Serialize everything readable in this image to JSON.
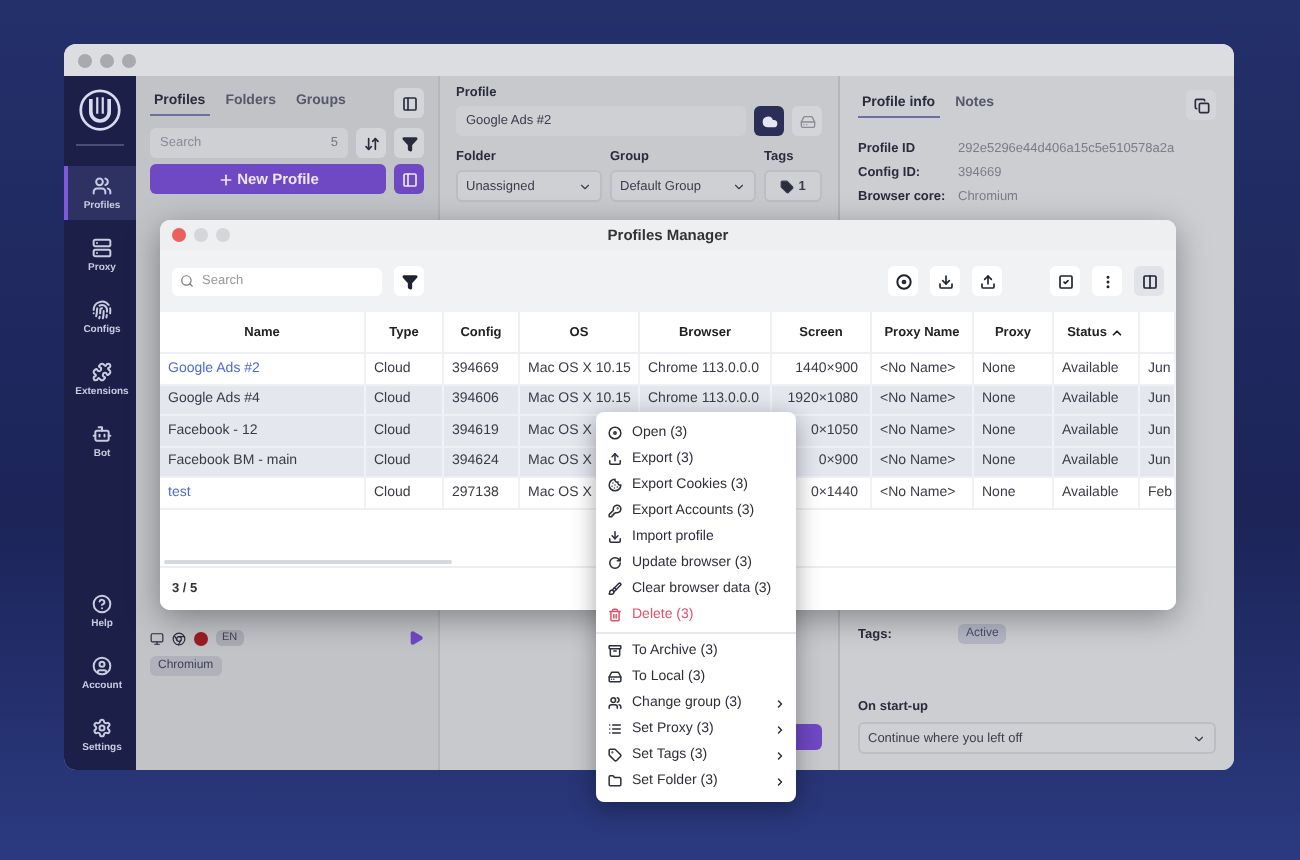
{
  "sidebar": {
    "items": [
      {
        "label": "Profiles",
        "selected": true
      },
      {
        "label": "Proxy",
        "selected": false
      },
      {
        "label": "Configs",
        "selected": false
      },
      {
        "label": "Extensions",
        "selected": false
      },
      {
        "label": "Bot",
        "selected": false
      }
    ],
    "bottom_items": [
      {
        "label": "Help"
      },
      {
        "label": "Account"
      },
      {
        "label": "Settings"
      }
    ]
  },
  "profiles_panel": {
    "tabs": [
      {
        "label": "Profiles",
        "selected": true
      },
      {
        "label": "Folders",
        "selected": false
      },
      {
        "label": "Groups",
        "selected": false
      }
    ],
    "search": {
      "placeholder": "Search",
      "count": "5"
    },
    "new_profile_button": "New Profile",
    "profile_card": {
      "language": "EN",
      "browser_tag": "Chromium"
    }
  },
  "profile_editor": {
    "profile_label": "Profile",
    "profile_name": "Google Ads #2",
    "folder_label": "Folder",
    "folder_value": "Unassigned",
    "group_label": "Group",
    "group_value": "Default Group",
    "tags_label": "Tags",
    "tags_count": "1"
  },
  "profile_info": {
    "tabs": [
      {
        "label": "Profile info",
        "selected": true
      },
      {
        "label": "Notes",
        "selected": false
      }
    ],
    "fields": [
      {
        "label": "Profile ID",
        "value": "292e5296e44d406a15c5e510578a2a"
      },
      {
        "label": "Config ID:",
        "value": "394669"
      },
      {
        "label": "Browser core:",
        "value": "Chromium"
      }
    ],
    "tags_label": "Tags:",
    "tag": "Active",
    "startup_label": "On start-up",
    "startup_value": "Continue where you left off"
  },
  "profiles_manager": {
    "title": "Profiles Manager",
    "search": {
      "placeholder": "Search"
    },
    "columns": [
      {
        "label": "Name",
        "sorted": false
      },
      {
        "label": "Type",
        "sorted": false
      },
      {
        "label": "Config",
        "sorted": false
      },
      {
        "label": "OS",
        "sorted": false
      },
      {
        "label": "Browser",
        "sorted": false
      },
      {
        "label": "Screen",
        "sorted": false
      },
      {
        "label": "Proxy Name",
        "sorted": false
      },
      {
        "label": "Proxy",
        "sorted": false
      },
      {
        "label": "Status",
        "sorted": true
      },
      {
        "sorted": false
      }
    ],
    "rows": [
      {
        "selected": false,
        "cells": [
          "Google Ads #2",
          "Cloud",
          "394669",
          "Mac OS X 10.15",
          "Chrome 113.0.0.0",
          "1440×900",
          "<No Name>",
          "None",
          "Available",
          "Jun"
        ]
      },
      {
        "selected": true,
        "cells": [
          "Google Ads #4",
          "Cloud",
          "394606",
          "Mac OS X 10.15",
          "Chrome 113.0.0.0",
          "1920×1080",
          "<No Name>",
          "None",
          "Available",
          "Jun"
        ]
      },
      {
        "selected": true,
        "cells": [
          "Facebook - 12",
          "Cloud",
          "394619",
          "Mac OS X",
          null,
          "0×1050",
          "<No Name>",
          "None",
          "Available",
          "Jun"
        ]
      },
      {
        "selected": true,
        "cells": [
          "Facebook BM - main",
          "Cloud",
          "394624",
          "Mac OS X",
          null,
          "0×900",
          "<No Name>",
          "None",
          "Available",
          "Jun"
        ]
      },
      {
        "selected": false,
        "cells": [
          "test",
          "Cloud",
          "297138",
          "Mac OS X",
          null,
          "0×1440",
          "<No Name>",
          "None",
          "Available",
          "Feb"
        ]
      }
    ],
    "footer": "3 / 5"
  },
  "context_menu": {
    "sections": [
      [
        {
          "label": "Open (3)",
          "kind": "normal",
          "submenu": false
        },
        {
          "label": "Export (3)",
          "kind": "normal",
          "submenu": false
        },
        {
          "label": "Export Cookies (3)",
          "kind": "normal",
          "submenu": false
        },
        {
          "label": "Export Accounts (3)",
          "kind": "normal",
          "submenu": false
        },
        {
          "label": "Import profile",
          "kind": "normal",
          "submenu": false
        },
        {
          "label": "Update browser (3)",
          "kind": "normal",
          "submenu": false
        },
        {
          "label": "Clear browser data (3)",
          "kind": "normal",
          "submenu": false
        },
        {
          "label": "Delete (3)",
          "kind": "danger",
          "submenu": false
        }
      ],
      [
        {
          "label": "To Archive (3)",
          "kind": "normal",
          "submenu": false
        },
        {
          "label": "To Local (3)",
          "kind": "normal",
          "submenu": false
        },
        {
          "label": "Change group (3)",
          "kind": "normal",
          "submenu": true
        },
        {
          "label": "Set Proxy (3)",
          "kind": "normal",
          "submenu": true
        },
        {
          "label": "Set Tags (3)",
          "kind": "normal",
          "submenu": true
        },
        {
          "label": "Set Folder (3)",
          "kind": "normal",
          "submenu": true
        }
      ]
    ]
  }
}
